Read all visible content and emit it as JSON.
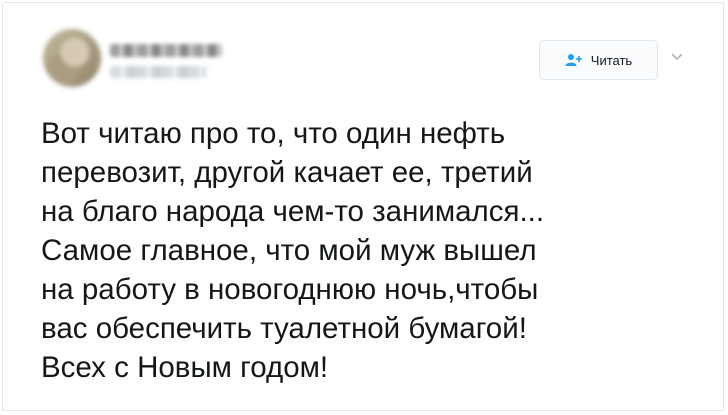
{
  "tweet": {
    "author_name_redacted": true,
    "follow_button": {
      "label": "Читать",
      "icon": "add-person-icon"
    },
    "menu_icon": "chevron-down-icon",
    "text_lines": [
      "Вот читаю про то, что один нефть",
      "перевозит, другой качает ее, третий",
      "на благо народа чем-то занимался...",
      "Самое главное, что мой муж вышел",
      "на работу в новогоднюю ночь,чтобы",
      "вас обеспечить туалетной бумагой!",
      "Всех с Новым годом!"
    ]
  },
  "colors": {
    "accent": "#1da1f2",
    "text": "#14171a",
    "border": "#e1e8ed"
  }
}
